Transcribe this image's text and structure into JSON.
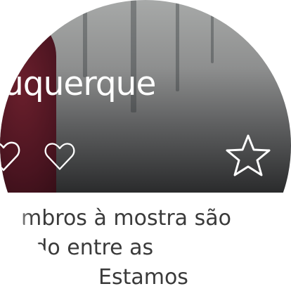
{
  "article": {
    "title": "uquerque",
    "body_lines": [
      "mbros à mostra são",
      "ido entre as",
      "Estamos"
    ]
  },
  "actions": {
    "like_icon": "heart-outline-icon",
    "favorite_icon": "star-outline-icon"
  },
  "colors": {
    "icon_stroke": "#ffffff",
    "text": "#3a3a3a",
    "accent_garment": "#6a1f2c"
  }
}
